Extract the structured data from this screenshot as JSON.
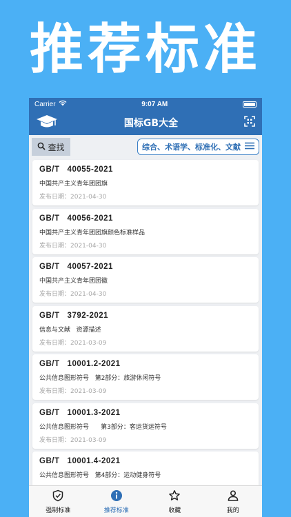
{
  "promo": {
    "title": "推荐标准"
  },
  "status_bar": {
    "carrier": "Carrier",
    "time": "9:07 AM"
  },
  "nav": {
    "title": "国标GB大全",
    "left_icon": "graduation-cap-icon",
    "right_icon": "qr-scan-icon"
  },
  "toolbar": {
    "search_label": "查找",
    "filter_label": "综合、术语学、标准化、文献"
  },
  "standards": [
    {
      "code": "GB/T   40055-2021",
      "name": "中国共产主义青年团团旗",
      "date": "发布日期：2021-04-30"
    },
    {
      "code": "GB/T   40056-2021",
      "name": "中国共产主义青年团团旗颜色标准样品",
      "date": "发布日期：2021-04-30"
    },
    {
      "code": "GB/T   40057-2021",
      "name": "中国共产主义青年团团徽",
      "date": "发布日期：2021-04-30"
    },
    {
      "code": "GB/T   3792-2021",
      "name": "信息与文献   资源描述",
      "date": "发布日期：2021-03-09"
    },
    {
      "code": "GB/T   10001.2-2021",
      "name": "公共信息图形符号   第2部分：旅游休闲符号",
      "date": "发布日期：2021-03-09"
    },
    {
      "code": "GB/T   10001.3-2021",
      "name": "公共信息图形符号      第3部分：客运货运符号",
      "date": "发布日期：2021-03-09"
    },
    {
      "code": "GB/T   10001.4-2021",
      "name": "公共信息图形符号   第4部分：运动健身符号",
      "date": ""
    }
  ],
  "tabs": [
    {
      "label": "强制标准",
      "icon": "shield-check-icon",
      "active": false
    },
    {
      "label": "推荐标准",
      "icon": "info-icon",
      "active": true
    },
    {
      "label": "收藏",
      "icon": "star-icon",
      "active": false
    },
    {
      "label": "我的",
      "icon": "person-icon",
      "active": false
    }
  ],
  "colors": {
    "background": "#4bb0f5",
    "nav": "#2f6fb5",
    "accent": "#2f6fb5"
  }
}
